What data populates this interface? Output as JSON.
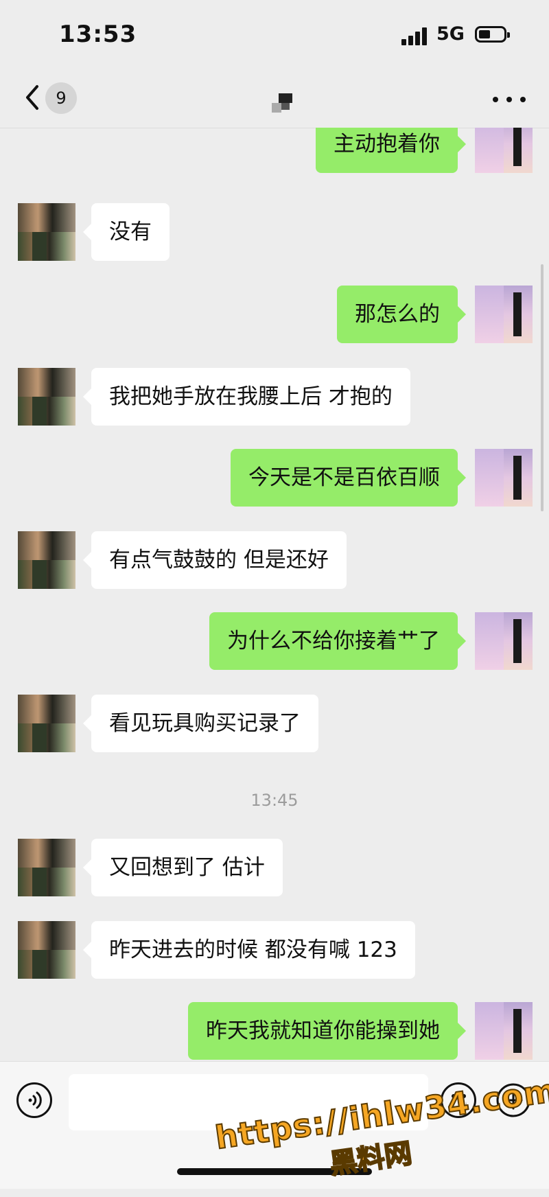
{
  "status_bar": {
    "time": "13:53",
    "network": "5G"
  },
  "nav": {
    "unread_count": "9"
  },
  "messages": [
    {
      "side": "right",
      "text": "主动抱着你"
    },
    {
      "side": "left",
      "text": "没有"
    },
    {
      "side": "right",
      "text": "那怎么的"
    },
    {
      "side": "left",
      "text": "我把她手放在我腰上后 才抱的"
    },
    {
      "side": "right",
      "text": "今天是不是百依百顺"
    },
    {
      "side": "left",
      "text": "有点气鼓鼓的 但是还好"
    },
    {
      "side": "right",
      "text": "为什么不给你接着艹了"
    },
    {
      "side": "left",
      "text": "看见玩具购买记录了"
    },
    {
      "timestamp": "13:45"
    },
    {
      "side": "left",
      "text": "又回想到了 估计"
    },
    {
      "side": "left",
      "text": "昨天进去的时候 都没有喊 123"
    },
    {
      "side": "right",
      "text": "昨天我就知道你能操到她"
    }
  ],
  "input": {
    "value": ""
  },
  "watermark": {
    "url": "https://ihlw34.com",
    "name": "黑料网"
  },
  "colors": {
    "background": "#ededed",
    "sent_bubble": "#95ec69",
    "received_bubble": "#ffffff",
    "watermark": "#f5a623"
  },
  "icons": {
    "back": "chevron-left-icon",
    "more": "more-dots-icon",
    "voice": "voice-icon",
    "emoji": "emoji-icon",
    "plus": "plus-icon"
  }
}
